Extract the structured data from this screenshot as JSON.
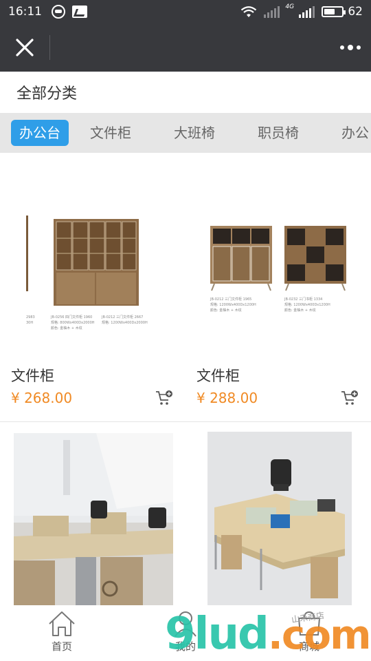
{
  "status_bar": {
    "time": "16:11",
    "network": "4G",
    "battery": "62",
    "battery_level": 0.62
  },
  "title_bar": {
    "close_icon": "close-icon",
    "more_icon": "more-dots-icon"
  },
  "all_categories": "全部分类",
  "tabs": [
    {
      "label": "办公台",
      "active": true
    },
    {
      "label": "文件柜",
      "active": false
    },
    {
      "label": "大班椅",
      "active": false
    },
    {
      "label": "职员椅",
      "active": false
    },
    {
      "label": "办公",
      "active": false
    }
  ],
  "products": [
    {
      "name": "文件柜",
      "price": "¥ 268.00"
    },
    {
      "name": "文件柜",
      "price": "¥ 288.00"
    },
    {
      "name": "",
      "price": ""
    },
    {
      "name": "",
      "price": ""
    }
  ],
  "bottom_nav": [
    {
      "label": "首页",
      "icon": "home-icon"
    },
    {
      "label": "我的",
      "icon": "user-icon"
    },
    {
      "label": "商城",
      "icon": "shop-icon"
    }
  ],
  "watermark": {
    "text": "9lud",
    "dot": ".com",
    "sub": "山禾商店"
  },
  "colors": {
    "accent": "#2f9ee8",
    "price": "#f08a24",
    "header": "#38393d"
  }
}
